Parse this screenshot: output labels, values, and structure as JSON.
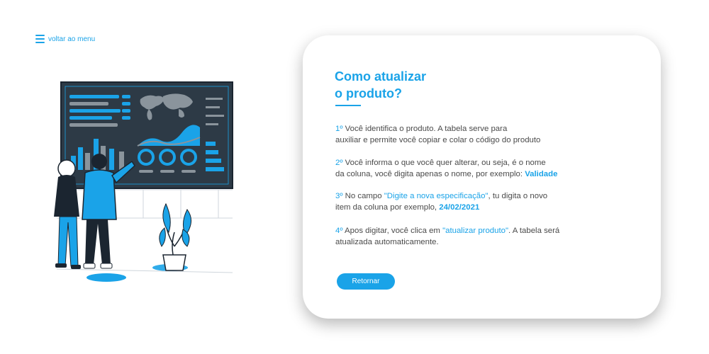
{
  "nav": {
    "back_label": "voltar ao menu"
  },
  "card": {
    "title_line1": "Como atualizar",
    "title_line2": "o produto?",
    "steps": [
      {
        "num": "1º",
        "line1": "Você identifica o produto. A tabela serve para",
        "line2": "auxiliar e permite você copiar  e colar o código do produto"
      },
      {
        "num": "2º",
        "line1": "Você informa  o que você quer alterar, ou seja,  é o nome",
        "line2_prefix": "da coluna, você digita apenas o nome, por exemplo: ",
        "line2_highlight": "Validade"
      },
      {
        "num": "3º",
        "line1_prefix": "No campo  ",
        "line1_highlight": "\"Digite a nova especificação\"",
        "line1_suffix": ", tu digita o novo",
        "line2_prefix": "item da coluna por exemplo,  ",
        "line2_highlight": "24/02/2021"
      },
      {
        "num": "4º",
        "line1_prefix": "Apos digitar, você clica em ",
        "line1_highlight": "\"atualizar produto\"",
        "line1_suffix": ".  A tabela será",
        "line2": "atualizada automaticamente."
      }
    ],
    "button_label": "Retornar"
  },
  "colors": {
    "accent": "#1aa3e8",
    "text": "#4a4a4a",
    "dashboard_bg": "#2d3a46"
  }
}
